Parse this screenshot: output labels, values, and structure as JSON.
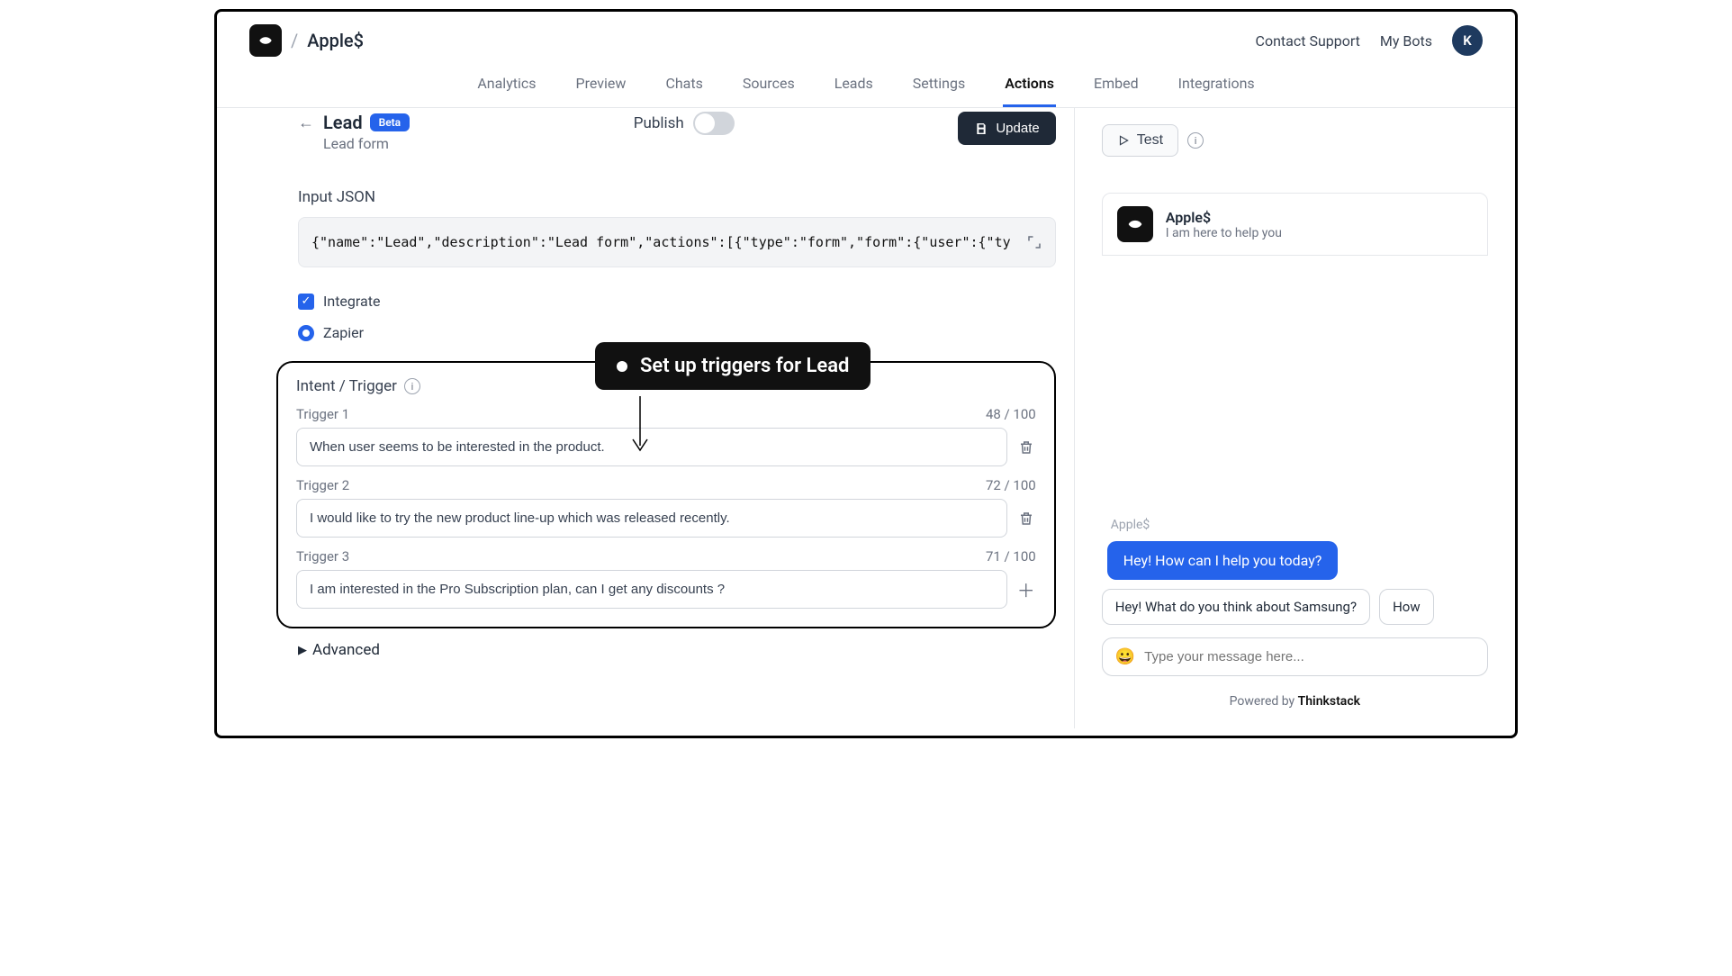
{
  "header": {
    "breadcrumb_title": "Apple$",
    "contact_support": "Contact Support",
    "my_bots": "My Bots",
    "avatar_initial": "K"
  },
  "tabs": [
    "Analytics",
    "Preview",
    "Chats",
    "Sources",
    "Leads",
    "Settings",
    "Actions",
    "Embed",
    "Integrations"
  ],
  "active_tab": "Actions",
  "page": {
    "title": "Lead",
    "badge": "Beta",
    "subtitle": "Lead form",
    "publish_label": "Publish",
    "update_label": "Update"
  },
  "input_json": {
    "label": "Input JSON",
    "value": "{\"name\":\"Lead\",\"description\":\"Lead form\",\"actions\":[{\"type\":\"form\",\"form\":{\"user\":{\"ty"
  },
  "options": {
    "integrate_label": "Integrate",
    "zapier_label": "Zapier"
  },
  "tooltip": "Set up triggers for Lead",
  "triggers": {
    "heading": "Intent / Trigger",
    "items": [
      {
        "label": "Trigger 1",
        "count": "48 / 100",
        "value": "When user seems to be interested in the product."
      },
      {
        "label": "Trigger 2",
        "count": "72 / 100",
        "value": "I would like to try the new product line-up which was released recently."
      },
      {
        "label": "Trigger 3",
        "count": "71 / 100",
        "value": "I am interested in the Pro Subscription plan, can I get any discounts ?"
      }
    ]
  },
  "advanced_label": "Advanced",
  "test_label": "Test",
  "bot": {
    "name": "Apple$",
    "subtitle": "I am here to help you",
    "sender_label": "Apple$",
    "greeting": "Hey! How can I help you today?"
  },
  "quick_replies": [
    "Hey! What do you think about Samsung?",
    "How"
  ],
  "chat_input": {
    "placeholder": "Type your message here..."
  },
  "powered_by": {
    "prefix": "Powered by ",
    "brand": "Thinkstack"
  }
}
